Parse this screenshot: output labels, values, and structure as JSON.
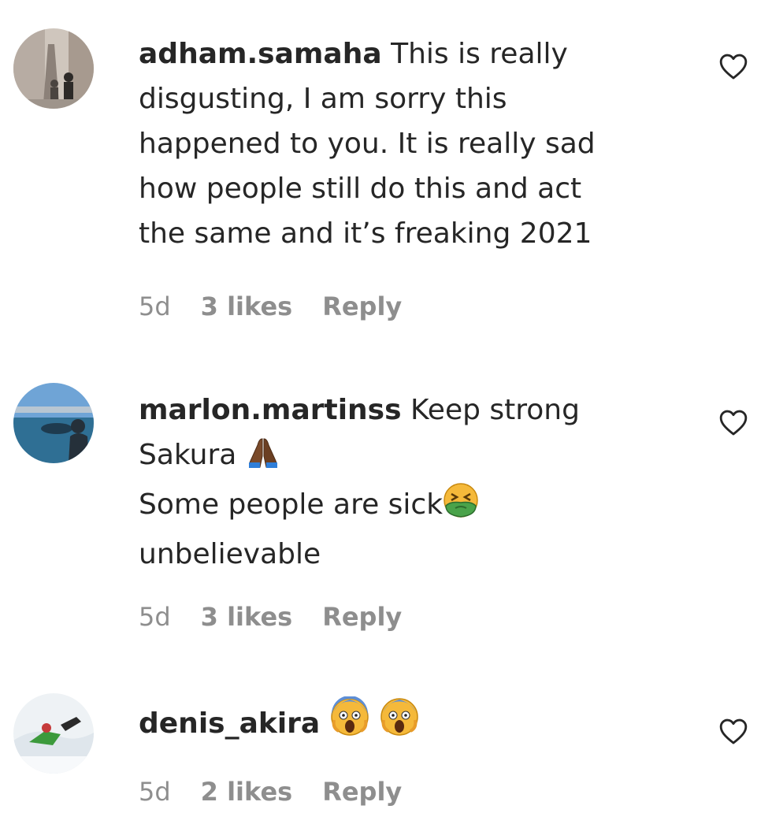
{
  "comments": [
    {
      "username": "adham.samaha",
      "lines": [
        "This is really",
        "disgusting, I am sorry this",
        "happened to you. It is really sad",
        "how people still do this and act",
        "the same and it’s freaking 2021"
      ],
      "time": "5d",
      "likes": "3 likes",
      "reply": "Reply",
      "avatar_icon": "avatar-eiffel-tower-photo"
    },
    {
      "username": "marlon.martinss",
      "lines": [
        "Keep strong",
        "Sakura",
        "Some people are sick",
        "unbelievable"
      ],
      "emojis": [
        "folded-hands-emoji",
        "nauseated-face-emoji"
      ],
      "time": "5d",
      "likes": "3 likes",
      "reply": "Reply",
      "avatar_icon": "avatar-seaside-photo"
    },
    {
      "username": "denis_akira",
      "lines": [
        ""
      ],
      "emojis": [
        "screaming-face-emoji",
        "screaming-face-emoji"
      ],
      "time": "5d",
      "likes": "2 likes",
      "reply": "Reply",
      "avatar_icon": "avatar-snow-photo"
    }
  ],
  "icons": {
    "like": "heart-outline-icon"
  },
  "colors": {
    "text": "#262626",
    "muted": "#8e8e8e"
  }
}
